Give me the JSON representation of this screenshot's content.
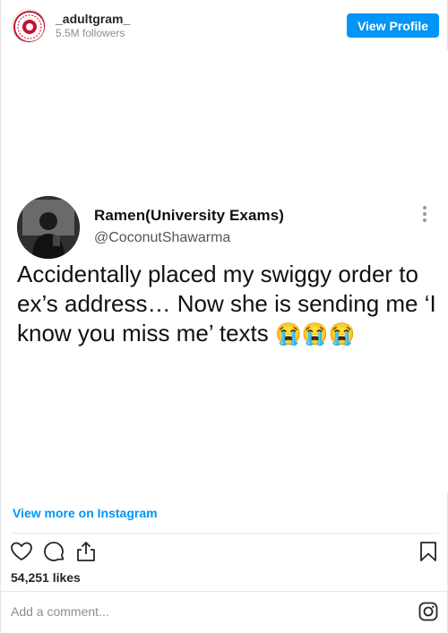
{
  "header": {
    "username": "_adultgram_",
    "followers": "5.5M followers",
    "view_profile_label": "View Profile"
  },
  "tweet": {
    "name": "Ramen(University Exams)",
    "handle": "@CoconutShawarma",
    "text": "Accidentally placed my swiggy order to ex’s address… Now she is sending me ‘I know you miss me’ texts",
    "emojis": "😭😭😭"
  },
  "view_more_label": "View more on Instagram",
  "likes": "54,251 likes",
  "comment": {
    "placeholder": "Add a comment..."
  },
  "icons": {
    "like": "heart-icon",
    "comment": "comment-bubble-icon",
    "share": "share-icon",
    "save": "bookmark-icon",
    "logo": "instagram-icon",
    "more": "more-vertical-icon"
  },
  "colors": {
    "accent": "#0095f6",
    "text": "#262626",
    "muted": "#8e8e8e",
    "border": "#e6e6e6"
  }
}
